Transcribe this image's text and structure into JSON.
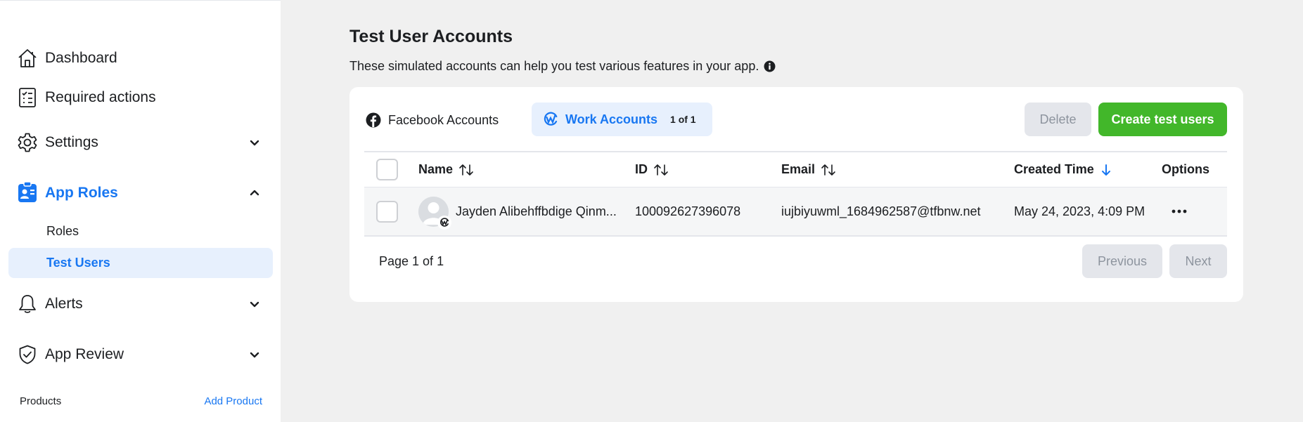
{
  "sidebar": {
    "dashboard": "Dashboard",
    "required_actions": "Required actions",
    "settings": "Settings",
    "app_roles": "App Roles",
    "roles": "Roles",
    "test_users": "Test Users",
    "alerts": "Alerts",
    "app_review": "App Review",
    "products": "Products",
    "add_product": "Add Product"
  },
  "main": {
    "title": "Test User Accounts",
    "description": "These simulated accounts can help you test various features in your app."
  },
  "tabs": {
    "facebook": "Facebook Accounts",
    "work": "Work Accounts",
    "work_count": "1 of 1"
  },
  "buttons": {
    "delete": "Delete",
    "create": "Create test users"
  },
  "table": {
    "headers": {
      "name": "Name",
      "id": "ID",
      "email": "Email",
      "created": "Created Time",
      "options": "Options"
    },
    "rows": [
      {
        "name": "Jayden Alibehffbdige Qinm...",
        "id": "100092627396078",
        "email": "iujbiyuwml_1684962587@tfbnw.net",
        "created": "May 24, 2023, 4:09 PM"
      }
    ]
  },
  "pagination": {
    "label": "Page 1 of 1",
    "previous": "Previous",
    "next": "Next"
  },
  "colors": {
    "accent": "#1877f2",
    "create_button": "#42b72a",
    "selected_bg": "#e7f0fd"
  },
  "icons": {
    "dashboard": "house-icon",
    "required_actions": "checklist-icon",
    "settings": "gear-icon",
    "app_roles": "id-badge-icon",
    "alerts": "bell-icon",
    "app_review": "shield-check-icon"
  }
}
